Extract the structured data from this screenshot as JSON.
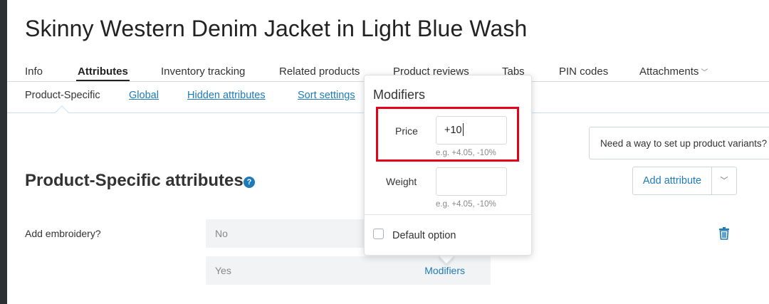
{
  "product": {
    "title": "Skinny Western Denim Jacket in Light Blue Wash"
  },
  "tabs": [
    {
      "label": "Info"
    },
    {
      "label": "Attributes"
    },
    {
      "label": "Inventory tracking"
    },
    {
      "label": "Related products"
    },
    {
      "label": "Product reviews"
    },
    {
      "label": "Tabs"
    },
    {
      "label": "PIN codes"
    },
    {
      "label": "Attachments"
    }
  ],
  "subtabs": [
    {
      "label": "Product-Specific"
    },
    {
      "label": "Global"
    },
    {
      "label": "Hidden attributes"
    },
    {
      "label": "Sort settings"
    }
  ],
  "notice": {
    "text": "Need a way to set up product variants?"
  },
  "section": {
    "title": "Product-Specific attributes",
    "help_symbol": "?"
  },
  "buttons": {
    "add_attribute": "Add attribute"
  },
  "attribute": {
    "label": "Add embroidery?",
    "options": [
      {
        "value": "No"
      },
      {
        "value": "Yes",
        "link": "Modifiers"
      }
    ]
  },
  "popover": {
    "title": "Modifiers",
    "price": {
      "label": "Price",
      "value": "+10",
      "hint": "e.g. +4.05, -10%"
    },
    "weight": {
      "label": "Weight",
      "value": "",
      "hint": "e.g. +4.05, -10%"
    },
    "default_option": {
      "label": "Default option",
      "checked": false
    }
  },
  "colors": {
    "accent": "#1f7ab8",
    "highlight": "#e5001a"
  }
}
